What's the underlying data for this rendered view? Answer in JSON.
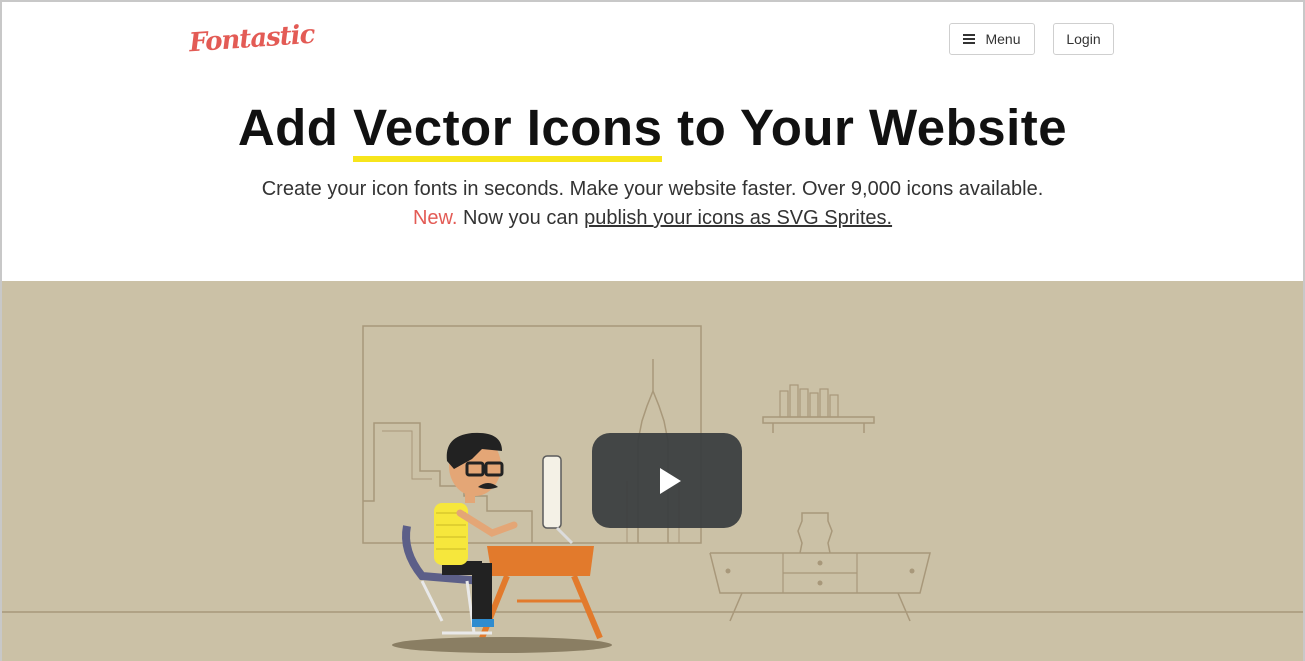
{
  "header": {
    "logo_text": "Fontastic",
    "menu_label": "Menu",
    "login_label": "Login"
  },
  "hero": {
    "headline_pre": "Add ",
    "headline_highlight": "Vector Icons",
    "headline_post": " to Your Website",
    "subtitle": "Create your icon fonts in seconds. Make your website faster. Over 9,000 icons available.",
    "new_label": "New.",
    "sprites_pre": " Now you can ",
    "sprites_link": "publish your icons as SVG Sprites."
  },
  "colors": {
    "brand": "#e35b55",
    "highlight": "#f7e51c",
    "hero_bg": "#cbc1a6"
  },
  "icons": [
    "hamburger-icon",
    "play-icon"
  ]
}
